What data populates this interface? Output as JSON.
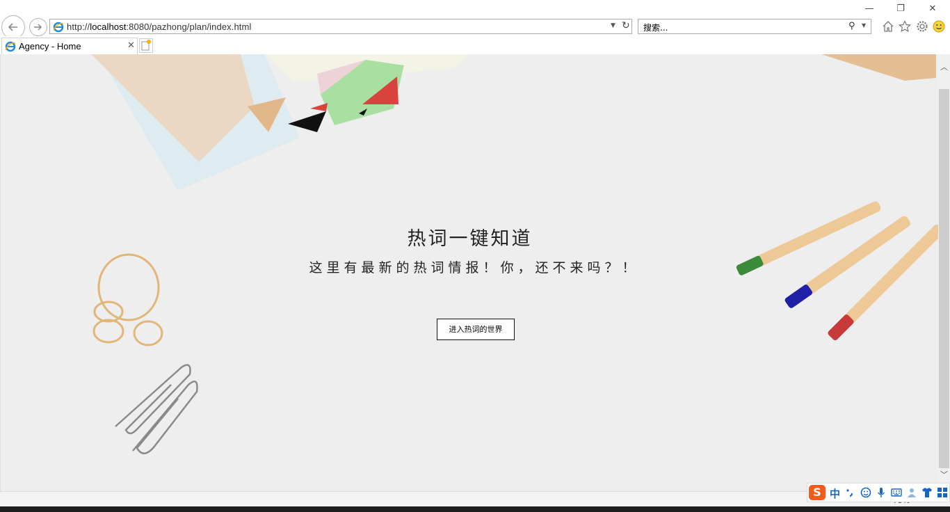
{
  "browser": {
    "url_prefix": "http://",
    "url_host": "localhost",
    "url_rest": ":8080/pazhong/plan/index.html",
    "search_placeholder": "搜索...",
    "tab_title": "Agency - Home",
    "window_controls": {
      "minimize": "—",
      "restore": "❐",
      "close": "✕"
    },
    "zoom": "75%"
  },
  "hero": {
    "title": "热词一键知道",
    "subtitle": "这里有最新的热词情报！你，还不来吗？！",
    "button_label": "进入热词的世界"
  },
  "ime": {
    "logo": "S",
    "mode": "中"
  },
  "icons": [
    "back-arrow-icon",
    "forward-arrow-icon",
    "ie-logo-icon",
    "dropdown-icon",
    "refresh-icon",
    "search-icon",
    "home-icon",
    "favorites-star-icon",
    "settings-gear-icon",
    "smiley-feedback-icon",
    "tab-close-icon",
    "new-tab-icon"
  ],
  "colors": {
    "page_bg": "#eeeeee",
    "button_border": "#111111",
    "ime_brand": "#f25b1c",
    "ime_blue": "#1666c5"
  }
}
